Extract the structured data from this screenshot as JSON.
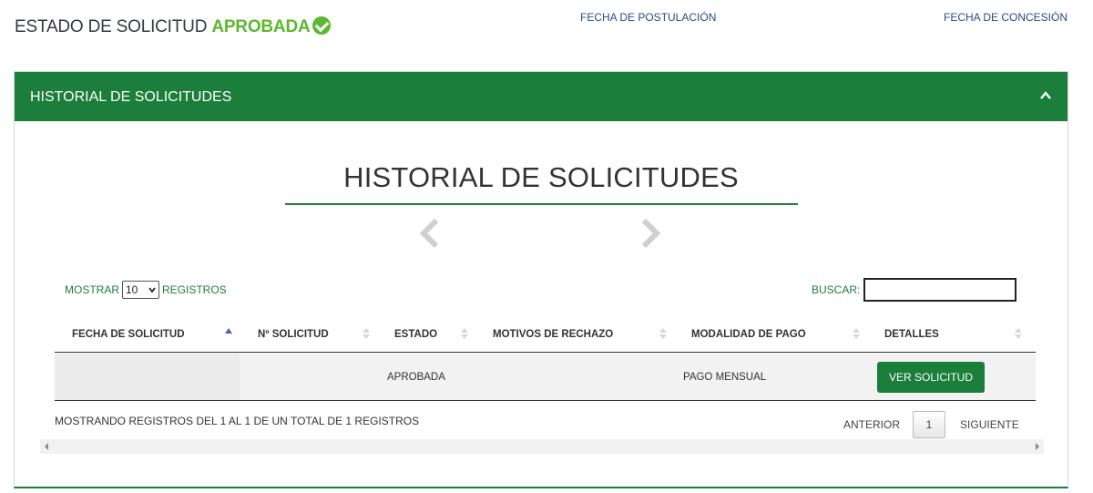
{
  "status": {
    "prefix": "ESTADO DE SOLICITUD",
    "value": "APROBADA",
    "icon": "check-circle-icon",
    "value_color": "#5cb82f"
  },
  "header_links": {
    "fecha_postulacion": "FECHA DE POSTULACIÓN",
    "fecha_concesion": "FECHA DE CONCESIÓN"
  },
  "panel": {
    "title": "HISTORIAL DE SOLICITUDES",
    "toggle_icon": "chevron-up-icon",
    "accent_color": "#1b7e3a"
  },
  "section": {
    "title": "HISTORIAL DE SOLICITUDES",
    "prev_icon": "chevron-left-icon",
    "next_icon": "chevron-right-icon"
  },
  "length_control": {
    "label_before": "MOSTRAR",
    "selected": "10",
    "label_after": "REGISTROS"
  },
  "search": {
    "label": "BUSCAR:",
    "value": ""
  },
  "table": {
    "columns": [
      "FECHA DE SOLICITUD",
      "Nº SOLICITUD",
      "ESTADO",
      "MOTIVOS DE RECHAZO",
      "MODALIDAD DE PAGO",
      "DETALLES"
    ],
    "sorted_column": "FECHA DE SOLICITUD",
    "rows": [
      {
        "fecha": "",
        "numero": "",
        "estado": "APROBADA",
        "motivos": "",
        "modalidad": "PAGO MENSUAL",
        "detalles_button": "VER SOLICITUD"
      }
    ]
  },
  "footer": {
    "info": "MOSTRANDO REGISTROS DEL 1 AL 1 DE UN TOTAL DE 1 REGISTROS",
    "prev": "ANTERIOR",
    "page": "1",
    "next": "SIGUIENTE"
  }
}
